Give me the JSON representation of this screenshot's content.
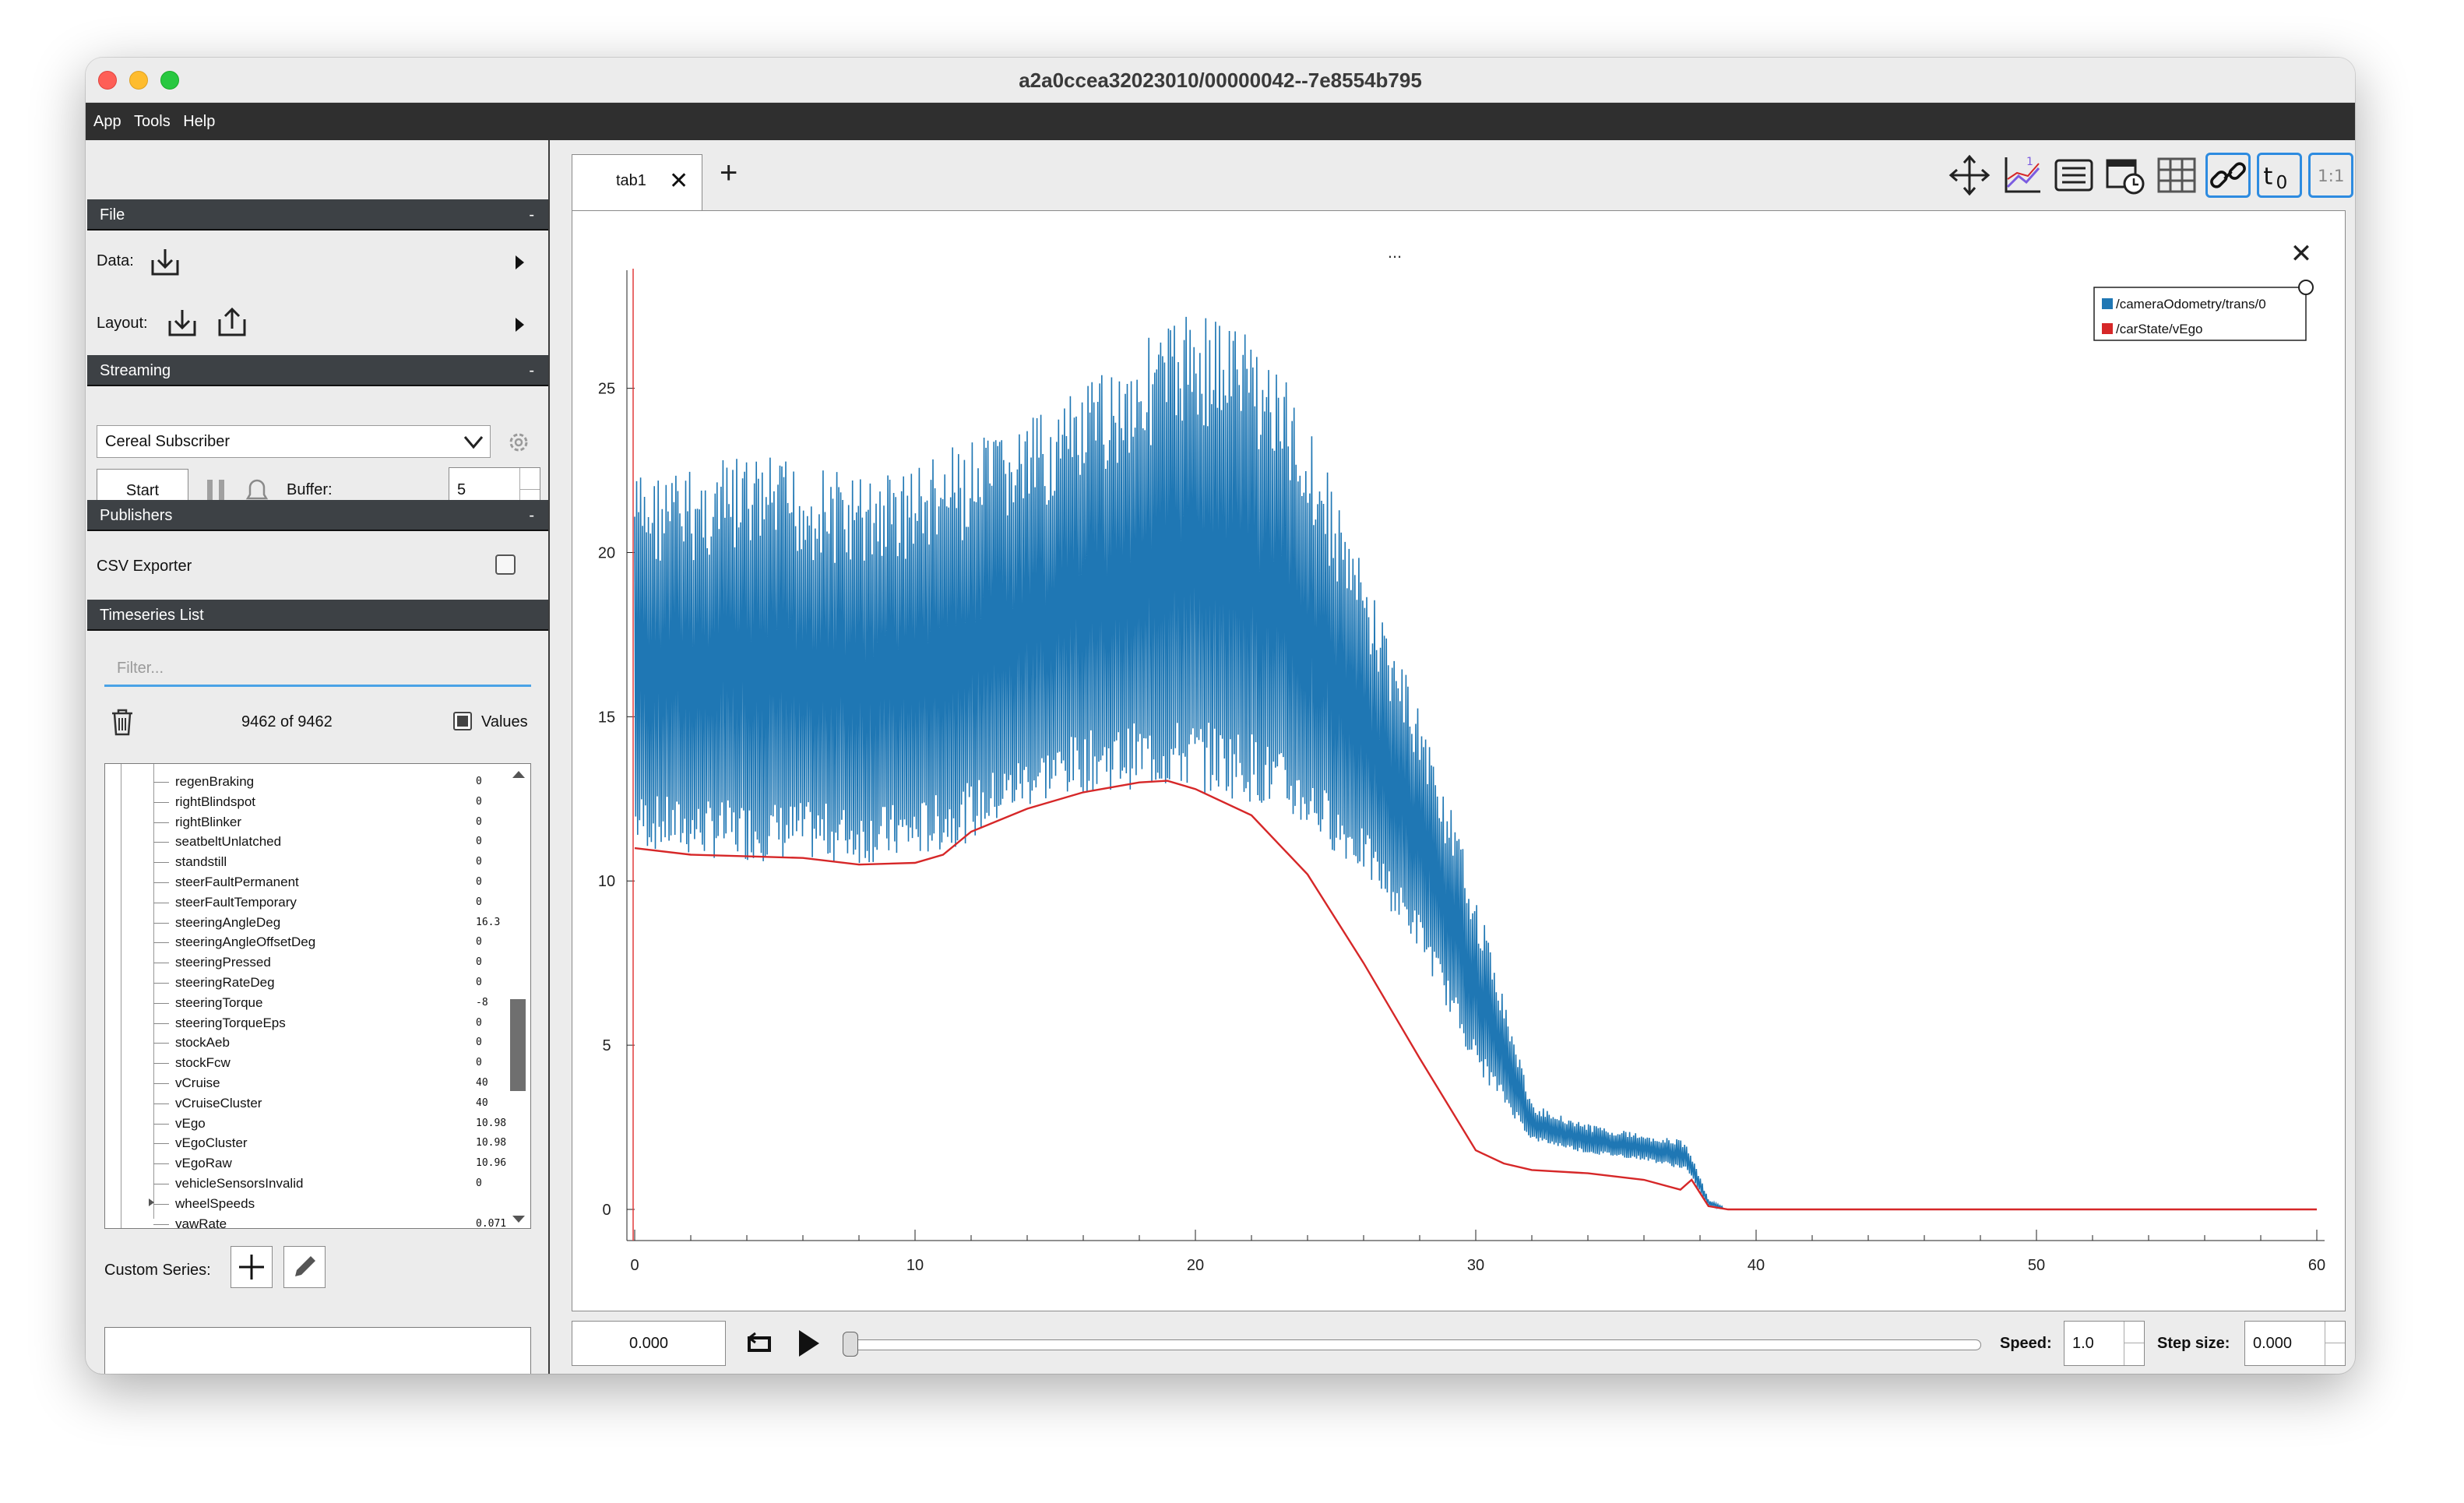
{
  "window": {
    "title": "a2a0ccea32023010/00000042--7e8554b795"
  },
  "menu": [
    "App",
    "Tools",
    "Help"
  ],
  "file": {
    "header": "File",
    "collapse": "-",
    "data_label": "Data:",
    "layout_label": "Layout:"
  },
  "streaming": {
    "header": "Streaming",
    "collapse": "-",
    "source": "Cereal Subscriber",
    "start_label": "Start",
    "buffer_label": "Buffer:",
    "buffer_value": "5"
  },
  "publishers": {
    "header": "Publishers",
    "collapse": "-",
    "csv_label": "CSV Exporter"
  },
  "timeseries": {
    "header": "Timeseries List",
    "filter_placeholder": "Filter...",
    "count": "9462 of 9462",
    "values_label": "Values",
    "items": [
      {
        "name": "regenBraking",
        "value": "0"
      },
      {
        "name": "rightBlindspot",
        "value": "0"
      },
      {
        "name": "rightBlinker",
        "value": "0"
      },
      {
        "name": "seatbeltUnlatched",
        "value": "0"
      },
      {
        "name": "standstill",
        "value": "0"
      },
      {
        "name": "steerFaultPermanent",
        "value": "0"
      },
      {
        "name": "steerFaultTemporary",
        "value": "0"
      },
      {
        "name": "steeringAngleDeg",
        "value": "16.3"
      },
      {
        "name": "steeringAngleOffsetDeg",
        "value": "0"
      },
      {
        "name": "steeringPressed",
        "value": "0"
      },
      {
        "name": "steeringRateDeg",
        "value": "0"
      },
      {
        "name": "steeringTorque",
        "value": "-8"
      },
      {
        "name": "steeringTorqueEps",
        "value": "0"
      },
      {
        "name": "stockAeb",
        "value": "0"
      },
      {
        "name": "stockFcw",
        "value": "0"
      },
      {
        "name": "vCruise",
        "value": "40"
      },
      {
        "name": "vCruiseCluster",
        "value": "40"
      },
      {
        "name": "vEgo",
        "value": "10.98"
      },
      {
        "name": "vEgoCluster",
        "value": "10.98"
      },
      {
        "name": "vEgoRaw",
        "value": "10.96"
      },
      {
        "name": "vehicleSensorsInvalid",
        "value": "0"
      },
      {
        "name": "wheelSpeeds",
        "value": ""
      },
      {
        "name": "yawRate",
        "value": "0.071"
      }
    ],
    "custom_series_label": "Custom Series:"
  },
  "tabs": [
    {
      "label": "tab1",
      "close": "✕"
    }
  ],
  "add_tab": "+",
  "plot": {
    "title": "...",
    "close": "✕"
  },
  "chart_data": {
    "type": "line",
    "title": "...",
    "xlim": [
      0,
      60
    ],
    "ylim": [
      0,
      28.5
    ],
    "x_ticks": [
      "0",
      "10",
      "20",
      "30",
      "40",
      "50",
      "60"
    ],
    "y_ticks": [
      "0",
      "5",
      "10",
      "15",
      "20",
      "25"
    ],
    "legend_position": "top-right",
    "grid": false,
    "cursor_x": 0,
    "series": [
      {
        "name": "/cameraOdometry/trans/0",
        "color": "#1f77b4",
        "kind": "oscillating-band",
        "x": [
          0,
          2,
          4,
          6,
          8,
          10,
          12,
          14,
          16,
          18,
          20,
          22,
          24,
          26,
          28,
          30,
          32,
          34,
          36,
          37.5,
          38.3,
          39,
          40,
          60
        ],
        "low": [
          11,
          10.7,
          10.6,
          10.6,
          10.5,
          10.6,
          11.2,
          12.2,
          12.7,
          12.8,
          12.7,
          12.4,
          11.5,
          10.2,
          7.9,
          4.3,
          2.1,
          1.7,
          1.5,
          1.2,
          0.1,
          0,
          0,
          0
        ],
        "high": [
          22.5,
          22.6,
          23,
          22.8,
          22.4,
          22.8,
          23.4,
          24,
          25,
          26.5,
          27.6,
          27,
          24.2,
          19.5,
          15.3,
          9.7,
          3.2,
          2.6,
          2.3,
          2.1,
          0.3,
          0,
          0,
          0
        ]
      },
      {
        "name": "/carState/vEgo",
        "color": "#d62728",
        "kind": "line",
        "x": [
          0,
          2,
          4,
          6,
          8,
          10,
          11,
          12,
          14,
          16,
          18,
          19,
          20,
          22,
          24,
          26,
          28,
          29,
          30,
          31,
          32,
          34,
          36,
          37.3,
          37.7,
          38.3,
          39,
          40,
          60
        ],
        "y": [
          11.0,
          10.8,
          10.75,
          10.7,
          10.5,
          10.55,
          10.8,
          11.5,
          12.2,
          12.7,
          13.0,
          13.05,
          12.8,
          12.0,
          10.2,
          7.5,
          4.6,
          3.2,
          1.8,
          1.4,
          1.2,
          1.1,
          0.9,
          0.6,
          0.9,
          0.1,
          0,
          0,
          0
        ]
      }
    ]
  }
}
